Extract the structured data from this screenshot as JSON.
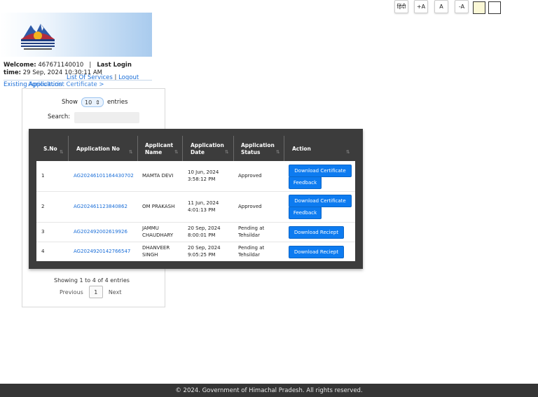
{
  "accessibility": {
    "language_label": "हिंदी",
    "font_increase_label": "+A",
    "font_normal_label": "A",
    "font_decrease_label": "-A"
  },
  "header": {
    "welcome_label": "Welcome:",
    "user_id": "467671140010",
    "separator": "|",
    "last_login_label": "Last Login",
    "time_label": "time:",
    "last_login_time": "29 Sep, 2024 10:30:11 AM"
  },
  "top_links": {
    "list_of_services": "List Of Services",
    "divider": "|",
    "logout": "Logout"
  },
  "breadcrumb": {
    "overlap_a": "Existing Application",
    "overlap_b": "Agriculturist Certificate >"
  },
  "table_controls": {
    "show_label": "Show",
    "entries_per_page": "10",
    "entries_label": "entries",
    "search_label": "Search:",
    "search_value": ""
  },
  "table": {
    "columns": [
      "S.No",
      "Application No",
      "Applicant Name",
      "Application Date",
      "Application Status",
      "Action"
    ],
    "rows": [
      {
        "sno": "1",
        "app_no": "AG20246101164430702",
        "name": "MAMTA DEVI",
        "date": "10 Jun, 2024",
        "time": "3:58:12 PM",
        "status": "Approved",
        "actions": [
          "Download Certificate",
          "Feedback"
        ]
      },
      {
        "sno": "2",
        "app_no": "AG20246112384086 2",
        "name": "OM PRAKASH",
        "date": "11 Jun, 2024",
        "time": "4:01:13 PM",
        "status": "Approved",
        "actions": [
          "Download Certificate",
          "Feedback"
        ]
      },
      {
        "sno": "3",
        "app_no": "AG202492002619926",
        "name": "JAMMU CHAUDHARY",
        "date": "20 Sep, 2024",
        "time": "8:00:01 PM",
        "status": "Pending at Tehsildar",
        "actions": [
          "Download Reciept"
        ]
      },
      {
        "sno": "4",
        "app_no": "AG2024920142766547",
        "name": "DHANVEER SINGH",
        "date": "20 Sep, 2024",
        "time": "9:05:25 PM",
        "status": "Pending at Tehsildar",
        "actions": [
          "Download Reciept"
        ]
      }
    ]
  },
  "pagination": {
    "info": "Showing 1 to 4 of 4 entries",
    "previous": "Previous",
    "current_page": "1",
    "next": "Next"
  },
  "footer": {
    "text": "© 2024. Government of Himachal Pradesh. All rights reserved."
  },
  "colors": {
    "link": "#1a6ed8",
    "button_primary": "#0d7bf0",
    "table_header_bg": "#3c3c3c",
    "footer_bg": "#353535"
  }
}
